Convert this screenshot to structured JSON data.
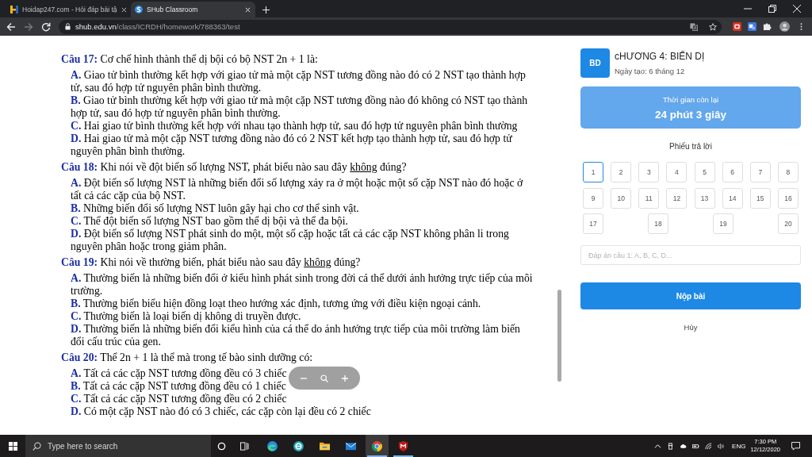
{
  "browser": {
    "tabs": [
      {
        "kind": "hoidap",
        "title": "Hoidap247.com - Hỏi đáp bài tậ",
        "selected": false
      },
      {
        "kind": "shub",
        "title": "SHub Classroom",
        "selected": true
      }
    ],
    "address": {
      "domain": "shub.edu.vn",
      "path": "/class/ICRDH/homework/788363/test"
    }
  },
  "document": {
    "questions": [
      {
        "label": "Câu 17:",
        "segments": [
          {
            "text": "Cơ chế hình thành thể dị bội có bộ NST 2n + 1 là:",
            "underline": false
          }
        ],
        "options": [
          {
            "letter": "A.",
            "text": "Giao tử bình thường kết hợp với giao tử mà một cặp NST tương đồng nào đó có 2 NST tạo thành hợp tử, sau đó hợp tử nguyên phân bình thường."
          },
          {
            "letter": "B.",
            "text": "Giao tử bình thường kết hợp với giao tử mà một cặp NST tương đồng nào đó không có NST tạo thành hợp tử, sau đó hợp tử nguyên phân bình thường."
          },
          {
            "letter": "C.",
            "text": "Hai giao tử bình thường kết hợp với nhau tạo thành hợp tử, sau đó hợp tử nguyên phân bình thường"
          },
          {
            "letter": "D.",
            "text": "Hai giao tử mà một cặp NST tương đồng nào đó có 2 NST kết hợp tạo thành hợp tử, sau đó hợp tử nguyên phân bình thường."
          }
        ]
      },
      {
        "label": "Câu 18:",
        "segments": [
          {
            "text": "Khi nói về đột biến số lượng NST, phát biểu nào sau đây ",
            "underline": false
          },
          {
            "text": "không",
            "underline": true
          },
          {
            "text": " đúng?",
            "underline": false
          }
        ],
        "options": [
          {
            "letter": "A.",
            "text": "Đột biến số lượng NST là những biến đổi số lượng xảy ra ở một hoặc một số cặp NST nào đó hoặc ở tất cả các cặp của bộ NST."
          },
          {
            "letter": "B.",
            "text": "Những biến đổi số lượng NST luôn gây hại cho cơ thể sinh vật."
          },
          {
            "letter": "C.",
            "text": "Thể đột biến số lượng NST bao gồm thể dị bội và thể đa bội."
          },
          {
            "letter": "D.",
            "text": "Đột biến số lượng NST phát sinh do một, một số cặp hoặc tất cả các cặp NST không phân li trong nguyên phân hoặc trong giảm phân."
          }
        ]
      },
      {
        "label": "Câu 19:",
        "segments": [
          {
            "text": "Khi nói về thường biến, phát biểu nào sau đây ",
            "underline": false
          },
          {
            "text": "không",
            "underline": true
          },
          {
            "text": " đúng?",
            "underline": false
          }
        ],
        "options": [
          {
            "letter": "A.",
            "text": "Thường biến là những biến đổi ở kiểu hình phát sinh trong đời cá thể dưới ảnh hưởng trực tiếp của môi trường."
          },
          {
            "letter": "B.",
            "text": "Thường biến biểu hiện đồng loạt theo hướng xác định, tương ứng với điều kiện ngoại cảnh."
          },
          {
            "letter": "C.",
            "text": "Thường biến là loại biến dị không di truyền được."
          },
          {
            "letter": "D.",
            "text": "Thường biến là những biến đổi kiểu hình của cá thể do ảnh hưởng trực tiếp của môi trường làm biến đổi cấu trúc của gen."
          }
        ]
      },
      {
        "label": "Câu 20:",
        "segments": [
          {
            "text": "Thể 2n + 1 là thể mà trong tế bào sinh dưỡng có:",
            "underline": false
          }
        ],
        "options": [
          {
            "letter": "A.",
            "text": "Tất cả các cặp NST tương đồng đều có 3 chiếc"
          },
          {
            "letter": "B.",
            "text": "Tất cả các cặp NST tương đồng đều có 1 chiếc"
          },
          {
            "letter": "C.",
            "text": "Tất cả các cặp NST tương đồng đều có 2 chiếc"
          },
          {
            "letter": "D.",
            "text": "Có một cặp NST nào đó có 3 chiếc, các cặp còn lại đều có 2 chiếc"
          }
        ]
      }
    ]
  },
  "sidebar": {
    "avatar": "BD",
    "title": "cHƯƠNG 4: BIẾN DỊ",
    "created": "Ngày tạo: 6 tháng 12",
    "timer": {
      "label": "Thời gian còn lại",
      "value": "24 phút 3 giây"
    },
    "answer_sheet": {
      "title": "Phiếu trả lời",
      "items": [
        {
          "number": "1",
          "selected": true
        },
        {
          "number": "2",
          "selected": false
        },
        {
          "number": "3",
          "selected": false
        },
        {
          "number": "4",
          "selected": false
        },
        {
          "number": "5",
          "selected": false
        },
        {
          "number": "6",
          "selected": false
        },
        {
          "number": "7",
          "selected": false
        },
        {
          "number": "8",
          "selected": false
        },
        {
          "number": "9",
          "selected": false
        },
        {
          "number": "10",
          "selected": false
        },
        {
          "number": "11",
          "selected": false
        },
        {
          "number": "12",
          "selected": false
        },
        {
          "number": "13",
          "selected": false
        },
        {
          "number": "14",
          "selected": false
        },
        {
          "number": "15",
          "selected": false
        },
        {
          "number": "16",
          "selected": false
        },
        {
          "number": "17",
          "selected": false
        },
        {
          "number": "18",
          "selected": false
        },
        {
          "number": "19",
          "selected": false
        },
        {
          "number": "20",
          "selected": false
        }
      ]
    },
    "answer_input": {
      "placeholder": "Đáp án câu 1: A, B, C, D..."
    },
    "submit_button": "Nộp bài",
    "cancel_link": "Hủy"
  },
  "taskbar": {
    "search": {
      "placeholder": "Type here to search"
    },
    "apps": [
      {
        "kind": "edge",
        "running": false,
        "selected": false
      },
      {
        "kind": "ie",
        "running": false,
        "selected": false
      },
      {
        "kind": "explorer",
        "running": false,
        "selected": false
      },
      {
        "kind": "mail",
        "running": false,
        "selected": false
      },
      {
        "kind": "chrome",
        "running": true,
        "selected": true
      },
      {
        "kind": "mcafee",
        "running": true,
        "selected": false
      }
    ],
    "language": "ENG",
    "time": "7:30 PM",
    "date": "12/12/2020"
  }
}
